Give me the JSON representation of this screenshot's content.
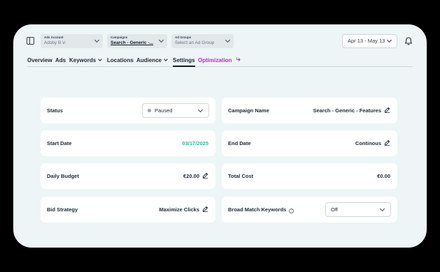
{
  "header": {
    "ads_account": {
      "label": "Ads Account",
      "value": "Adsby B.V."
    },
    "campaigns": {
      "label": "Campaigns",
      "value": "Search - Generic -..."
    },
    "ad_groups": {
      "label": "Ad Groups",
      "value": "Select an Ad Group"
    },
    "date_range": "Apr 13 - May 13"
  },
  "tabs": [
    {
      "label": "Overview"
    },
    {
      "label": "Ads"
    },
    {
      "label": "Keywords"
    },
    {
      "label": "Locations"
    },
    {
      "label": "Audience"
    },
    {
      "label": "Settings"
    },
    {
      "label": "Optimization"
    }
  ],
  "settings": {
    "status": {
      "label": "Status",
      "value": "Paused"
    },
    "campaign_name": {
      "label": "Campaign Name",
      "value": "Search - Generic - Features"
    },
    "start_date": {
      "label": "Start Date",
      "value": "03/17/2025"
    },
    "end_date": {
      "label": "End Date",
      "value": "Continous"
    },
    "daily_budget": {
      "label": "Daily Budget",
      "value": "€20.00"
    },
    "total_cost": {
      "label": "Total Cost",
      "value": "€0.00"
    },
    "bid_strategy": {
      "label": "Bid Strategy",
      "value": "Maximize Clicks"
    },
    "broad_match": {
      "label": "Broad Match Keywords",
      "value": "Off",
      "help": "?"
    }
  },
  "colors": {
    "accent_teal": "#2bb5a6",
    "optimization_magenta": "#c026d3",
    "panel_bg": "#eef5f6"
  }
}
